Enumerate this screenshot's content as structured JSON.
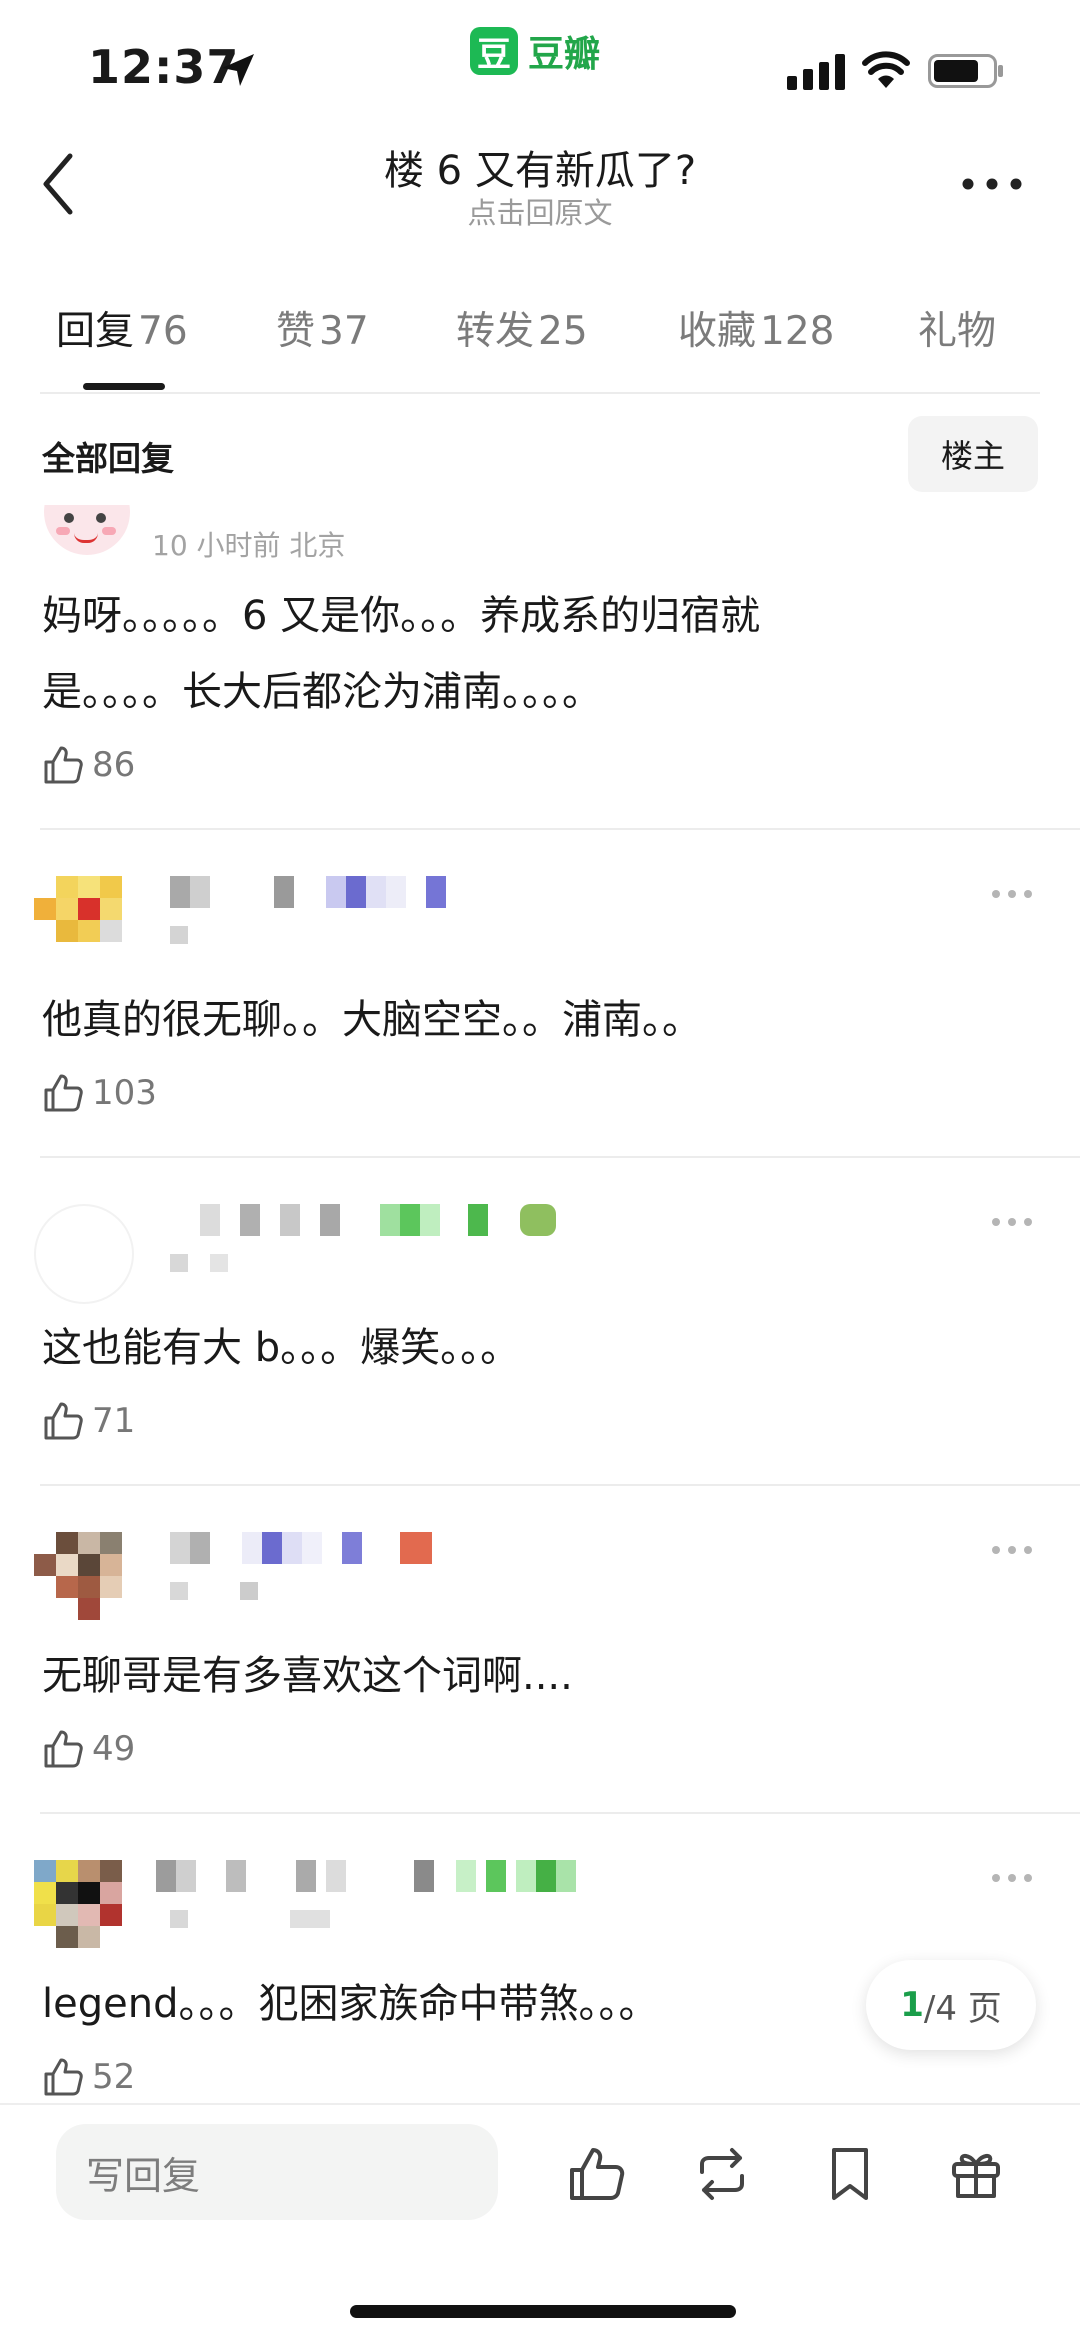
{
  "status_bar": {
    "time": "12:37"
  },
  "app_badge": {
    "logo_char": "豆",
    "name": "豆瓣"
  },
  "header": {
    "title": "楼 6 又有新瓜了?",
    "subtitle": "点击回原文"
  },
  "tabs": [
    {
      "label": "回复",
      "count": "76",
      "active": true
    },
    {
      "label": "赞",
      "count": "37"
    },
    {
      "label": "转发",
      "count": "25"
    },
    {
      "label": "收藏",
      "count": "128"
    },
    {
      "label": "礼物",
      "count": ""
    }
  ],
  "filter": {
    "label": "全部回复",
    "op_button": "楼主"
  },
  "comments": [
    {
      "meta": "10 小时前  北京",
      "text_lines": [
        "妈呀。。。。。6 又是你。。。养成系的归宿就",
        "是。。。。长大后都沦为浦南。。。。"
      ],
      "likes": "86"
    },
    {
      "meta": "",
      "text_lines": [
        "他真的很无聊。。大脑空空。。浦南。。"
      ],
      "likes": "103"
    },
    {
      "meta": "",
      "text_lines": [
        "这也能有大 b。。。爆笑。。。"
      ],
      "likes": "71"
    },
    {
      "meta": "",
      "text_lines": [
        "无聊哥是有多喜欢这个词啊...."
      ],
      "likes": "49"
    },
    {
      "meta": "",
      "text_lines": [
        "legend。。。犯困家族命中带煞。。。"
      ],
      "likes": "52"
    }
  ],
  "pager": {
    "current": "1",
    "total_label": "/4 页"
  },
  "bottom_bar": {
    "reply_placeholder": "写回复"
  },
  "colors": {
    "accent": "#1db954",
    "text": "#1a1a1a",
    "muted": "#9a9a9a",
    "divider": "#ececec"
  },
  "icons": [
    "location-arrow-icon",
    "signal-icon",
    "wifi-icon",
    "battery-icon",
    "back-chevron-icon",
    "more-dots-icon",
    "thumb-up-icon",
    "repost-icon",
    "bookmark-icon",
    "gift-icon"
  ]
}
